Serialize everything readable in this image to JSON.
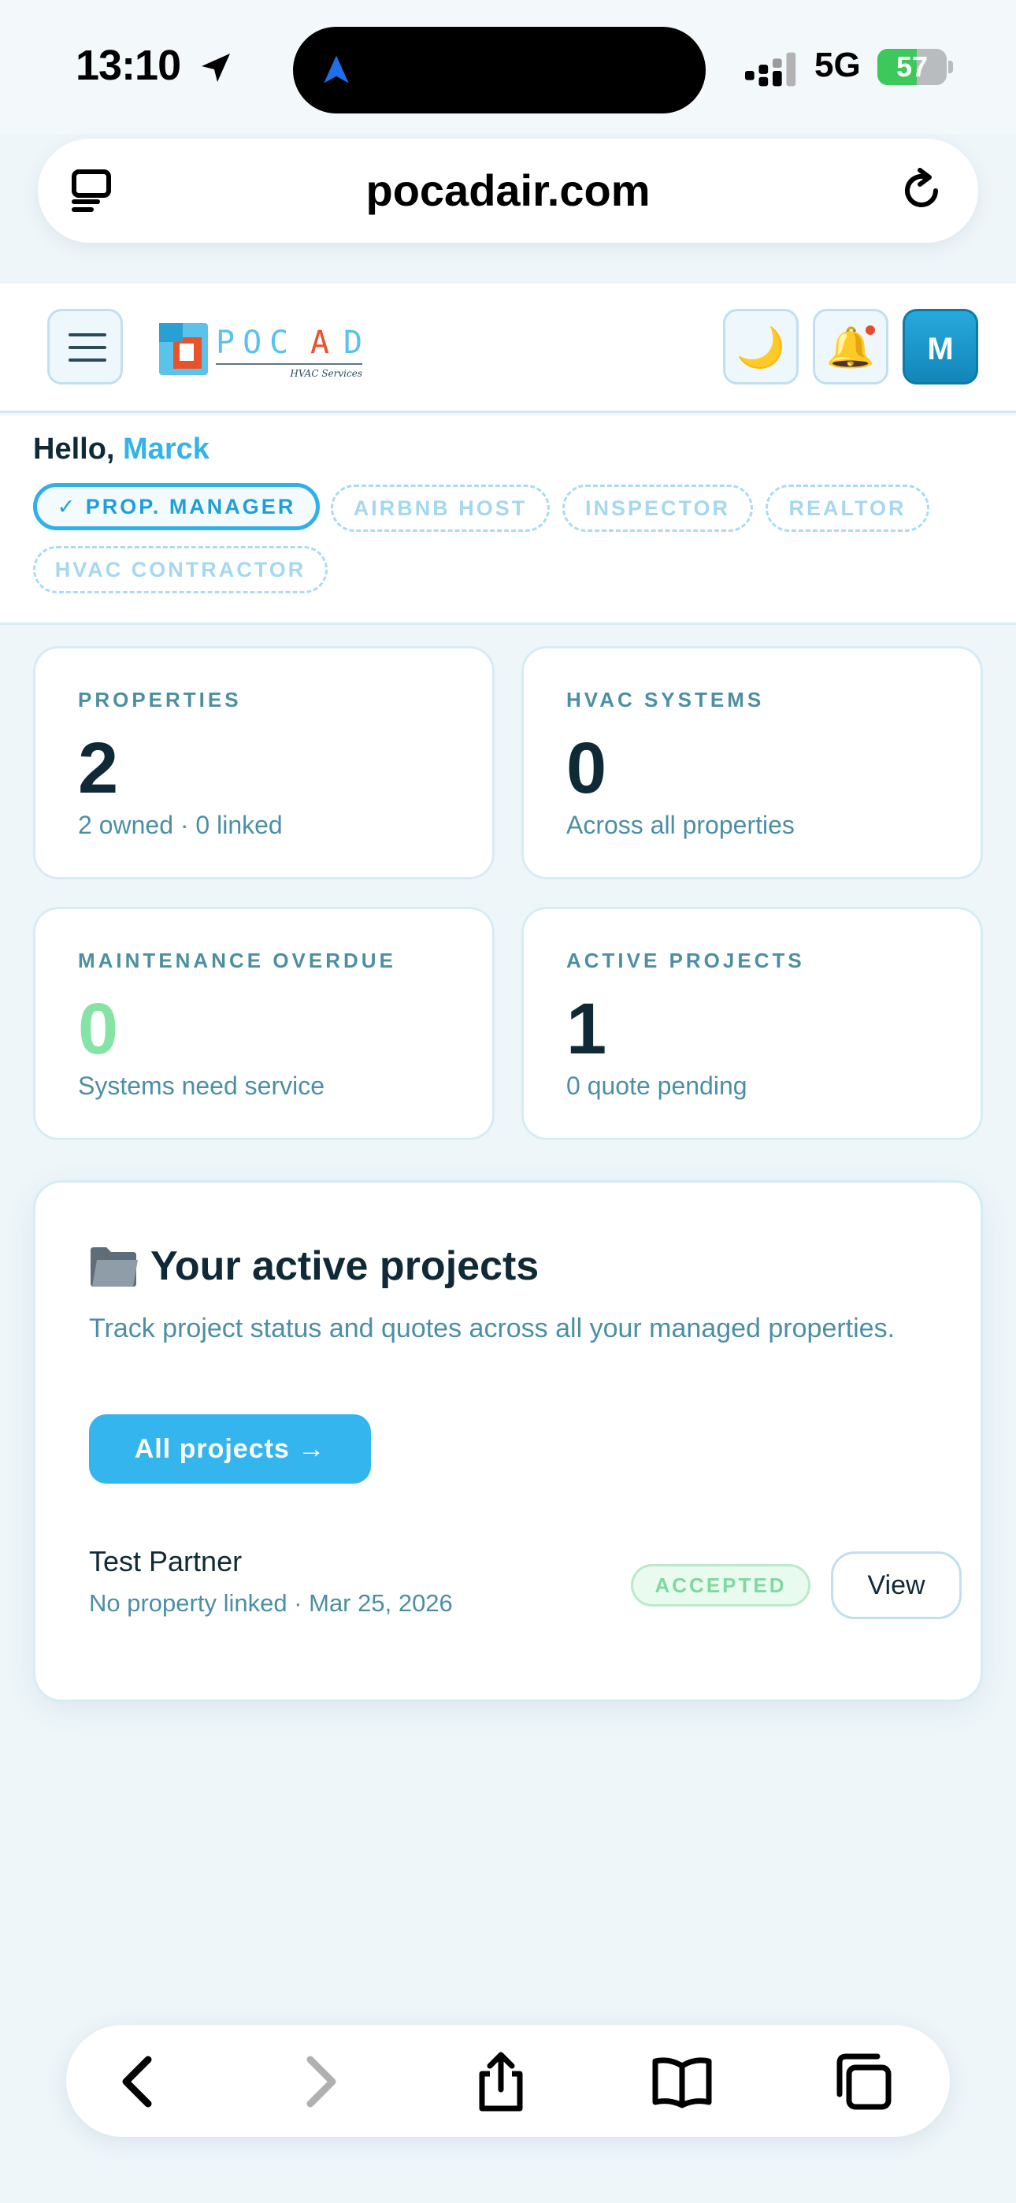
{
  "status_bar": {
    "time": "13:10",
    "network": "5G",
    "battery_percent": "57",
    "battery_level": 0.57
  },
  "browser": {
    "url": "pocadair.com"
  },
  "header": {
    "logo_text": "POCAD",
    "logo_tagline": "HVAC Services",
    "moon_glyph": "🌙",
    "bell_glyph": "🔔",
    "avatar_initial": "M"
  },
  "greeting": {
    "prefix": "Hello,",
    "name": "Marck"
  },
  "roles": [
    {
      "label": "✓ PROP. MANAGER",
      "active": true
    },
    {
      "label": "AIRBNB HOST",
      "active": false
    },
    {
      "label": "INSPECTOR",
      "active": false
    },
    {
      "label": "REALTOR",
      "active": false
    },
    {
      "label": "HVAC CONTRACTOR",
      "active": false
    }
  ],
  "stats": [
    {
      "label": "PROPERTIES",
      "value": "2",
      "sub": "2 owned · 0 linked"
    },
    {
      "label": "HVAC SYSTEMS",
      "value": "0",
      "sub": "Across all properties"
    },
    {
      "label": "MAINTENANCE OVERDUE",
      "value": "0",
      "sub": "Systems need service"
    },
    {
      "label": "ACTIVE PROJECTS",
      "value": "1",
      "sub": "0 quote pending"
    }
  ],
  "projects": {
    "title": "Your active projects",
    "description": "Track project status and quotes across all your managed properties.",
    "all_button": "All projects →",
    "items": [
      {
        "name": "Test Partner",
        "meta": "No property linked · Mar 25, 2026",
        "status": "ACCEPTED",
        "action": "View"
      }
    ]
  },
  "colors": {
    "accent": "#35b5ee",
    "ok_green": "#86e3a6",
    "text_dark": "#0f2a36",
    "text_muted": "#4b8fa6"
  },
  "icons": {
    "status": [
      "location-arrow-icon",
      "navigation-icon",
      "signal-icon",
      "battery-icon"
    ],
    "url_bar": [
      "tabs-icon",
      "reload-icon"
    ],
    "header": [
      "menu-icon",
      "moon-icon",
      "bell-icon"
    ],
    "toolbar": [
      "back-icon",
      "forward-icon",
      "share-icon",
      "bookmarks-icon",
      "tabs-overview-icon"
    ]
  }
}
